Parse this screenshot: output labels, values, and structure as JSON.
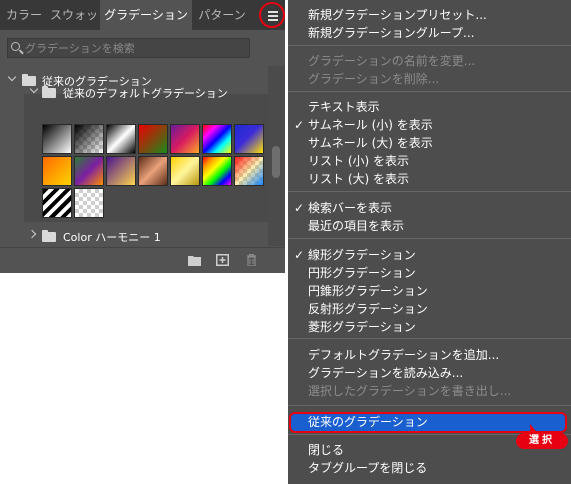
{
  "tabs": [
    {
      "label": "カラー"
    },
    {
      "label": "スウォッ"
    },
    {
      "label": "グラデーション"
    },
    {
      "label": "パターン"
    }
  ],
  "search": {
    "placeholder": "グラデーションを検索"
  },
  "tree": {
    "group_label": "従来のグラデーション",
    "subgroup_label": "従来のデフォルトグラデーション",
    "collapsed_group_label": "Color ハーモニー 1"
  },
  "thumbnails": [
    "linear-gradient(135deg,#000 0%,#fff 100%)",
    "checker-black",
    "linear-gradient(135deg,#000 0%,#fff 50%,#000 100%)",
    "linear-gradient(135deg,#e00 0%,#1a8a1a 100%)",
    "linear-gradient(135deg,#6a1b9a 0%,#d81b60 50%,#f9a825 100%)",
    "linear-gradient(135deg,#ff0000 0%,#ff00ff 25%,#0000ff 50%,#00ffff 70%,#ffff00 100%)",
    "linear-gradient(135deg,#1e2bd1 0%,#3b2bd8 45%,#ffe500 100%)",
    "linear-gradient(135deg,#ff6a00 0%,#ffd400 100%)",
    "linear-gradient(135deg,#2e7d32 0%,#7b1fa2 50%,#ff8f00 100%)",
    "linear-gradient(135deg,#4a148c 0%,#ffd54f 100%)",
    "linear-gradient(135deg,#5d2e16 0%,#e8a07a 50%,#5d2e16 100%)",
    "linear-gradient(135deg,#ffd000 0%,#fff59d 50%,#b7950b 100%)",
    "linear-gradient(135deg,#ff0000 0%,#ff9900 20%,#ffff00 40%,#00ff00 60%,#0000ff 80%,#ff00ff 100%)",
    "checker-rainbow",
    "stripes",
    "checker-plain"
  ],
  "menu": {
    "items": [
      {
        "label": "新規グラデーションプリセット...",
        "enabled": true,
        "checked": false
      },
      {
        "label": "新規グラデーショングループ...",
        "enabled": true,
        "checked": false
      },
      {
        "label": "グラデーションの名前を変更...",
        "enabled": false,
        "checked": false
      },
      {
        "label": "グラデーションを削除...",
        "enabled": false,
        "checked": false
      },
      {
        "label": "テキスト表示",
        "enabled": true,
        "checked": false
      },
      {
        "label": "サムネール (小) を表示",
        "enabled": true,
        "checked": true
      },
      {
        "label": "サムネール (大) を表示",
        "enabled": true,
        "checked": false
      },
      {
        "label": "リスト (小) を表示",
        "enabled": true,
        "checked": false
      },
      {
        "label": "リスト (大) を表示",
        "enabled": true,
        "checked": false
      },
      {
        "label": "検索バーを表示",
        "enabled": true,
        "checked": true
      },
      {
        "label": "最近の項目を表示",
        "enabled": true,
        "checked": false
      },
      {
        "label": "線形グラデーション",
        "enabled": true,
        "checked": true
      },
      {
        "label": "円形グラデーション",
        "enabled": true,
        "checked": false
      },
      {
        "label": "円錐形グラデーション",
        "enabled": true,
        "checked": false
      },
      {
        "label": "反射形グラデーション",
        "enabled": true,
        "checked": false
      },
      {
        "label": "菱形グラデーション",
        "enabled": true,
        "checked": false
      },
      {
        "label": "デフォルトグラデーションを追加...",
        "enabled": true,
        "checked": false
      },
      {
        "label": "グラデーションを読み込み...",
        "enabled": true,
        "checked": false
      },
      {
        "label": "選択したグラデーションを書き出し...",
        "enabled": false,
        "checked": false
      },
      {
        "label": "従来のグラデーション",
        "enabled": true,
        "checked": false,
        "highlighted": true
      },
      {
        "label": "閉じる",
        "enabled": true,
        "checked": false
      },
      {
        "label": "タブグループを閉じる",
        "enabled": true,
        "checked": false
      }
    ],
    "check_mark": "✓"
  },
  "callout": {
    "label": "選択"
  },
  "colors": {
    "highlight": "#1a5fcf",
    "annotation": "#e60012"
  }
}
